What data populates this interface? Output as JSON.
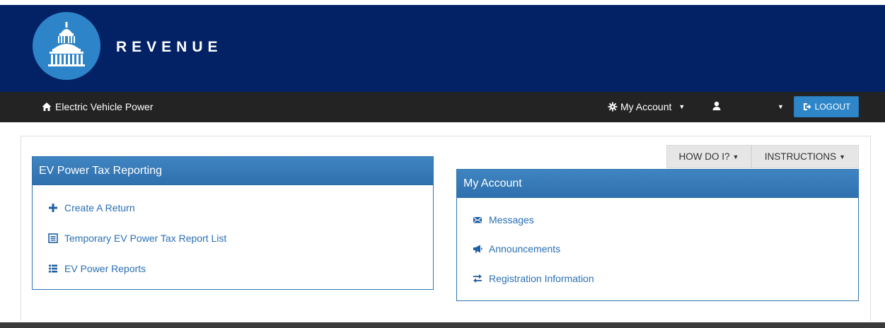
{
  "header": {
    "brand": "REVENUE"
  },
  "navbar": {
    "home_label": "Electric Vehicle Power",
    "account_label": "My Account",
    "user_label": "",
    "logout_label": "LOGOUT"
  },
  "help": {
    "how_do_i": "HOW DO I?",
    "instructions": "INSTRUCTIONS"
  },
  "panels": {
    "reporting": {
      "title": "EV Power Tax Reporting",
      "items": [
        {
          "label": "Create A Return",
          "icon": "plus-icon"
        },
        {
          "label": "Temporary EV Power Tax Report List",
          "icon": "list-box-icon"
        },
        {
          "label": "EV Power Reports",
          "icon": "list-icon"
        }
      ]
    },
    "account": {
      "title": "My Account",
      "items": [
        {
          "label": "Messages",
          "icon": "envelope-icon"
        },
        {
          "label": "Announcements",
          "icon": "bullhorn-icon"
        },
        {
          "label": "Registration Information",
          "icon": "transfer-icon"
        }
      ]
    }
  },
  "colors": {
    "header_bg": "#032266",
    "navbar_bg": "#232323",
    "panel_heading": "#337ab7",
    "link": "#2a6fb3",
    "logout_bg": "#2e86c9"
  }
}
